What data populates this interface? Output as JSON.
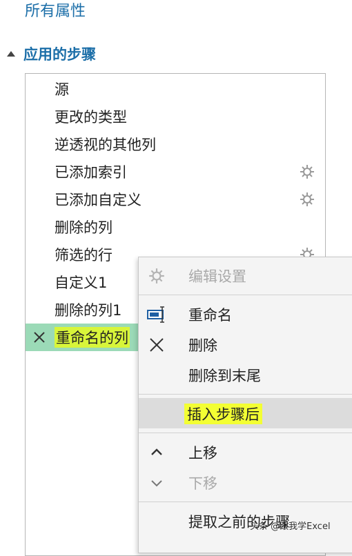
{
  "header": {
    "all_properties": "所有属性",
    "section_title": "应用的步骤"
  },
  "steps": [
    {
      "label": "源",
      "gear": false
    },
    {
      "label": "更改的类型",
      "gear": false
    },
    {
      "label": "逆透视的其他列",
      "gear": false
    },
    {
      "label": "已添加索引",
      "gear": true
    },
    {
      "label": "已添加自定义",
      "gear": true
    },
    {
      "label": "删除的列",
      "gear": false
    },
    {
      "label": "筛选的行",
      "gear": true
    },
    {
      "label": "自定义1",
      "gear": false
    },
    {
      "label": "删除的列1",
      "gear": false
    },
    {
      "label": "重命名的列",
      "gear": false,
      "selected": true
    }
  ],
  "context_menu": {
    "items": [
      {
        "label": "编辑设置",
        "icon": "gear-icon",
        "disabled": true
      },
      {
        "label": "重命名",
        "icon": "rename-icon",
        "disabled": false
      },
      {
        "label": "删除",
        "icon": "close-icon",
        "disabled": false
      },
      {
        "label": "删除到末尾",
        "icon": "",
        "disabled": false
      },
      {
        "label": "插入步骤后",
        "icon": "",
        "disabled": false,
        "highlighted": true
      },
      {
        "label": "上移",
        "icon": "chevron-up-icon",
        "disabled": false
      },
      {
        "label": "下移",
        "icon": "chevron-down-icon",
        "disabled": true
      },
      {
        "label": "提取之前的步骤",
        "icon": "",
        "disabled": false
      }
    ]
  },
  "watermark": "头条 @跟我学Excel",
  "colors": {
    "accent_blue": "#1b6ea8",
    "selected_bg": "#9bdab7",
    "highlight_yellow": "#f3ff33",
    "menu_bg": "#f4f4f4"
  }
}
